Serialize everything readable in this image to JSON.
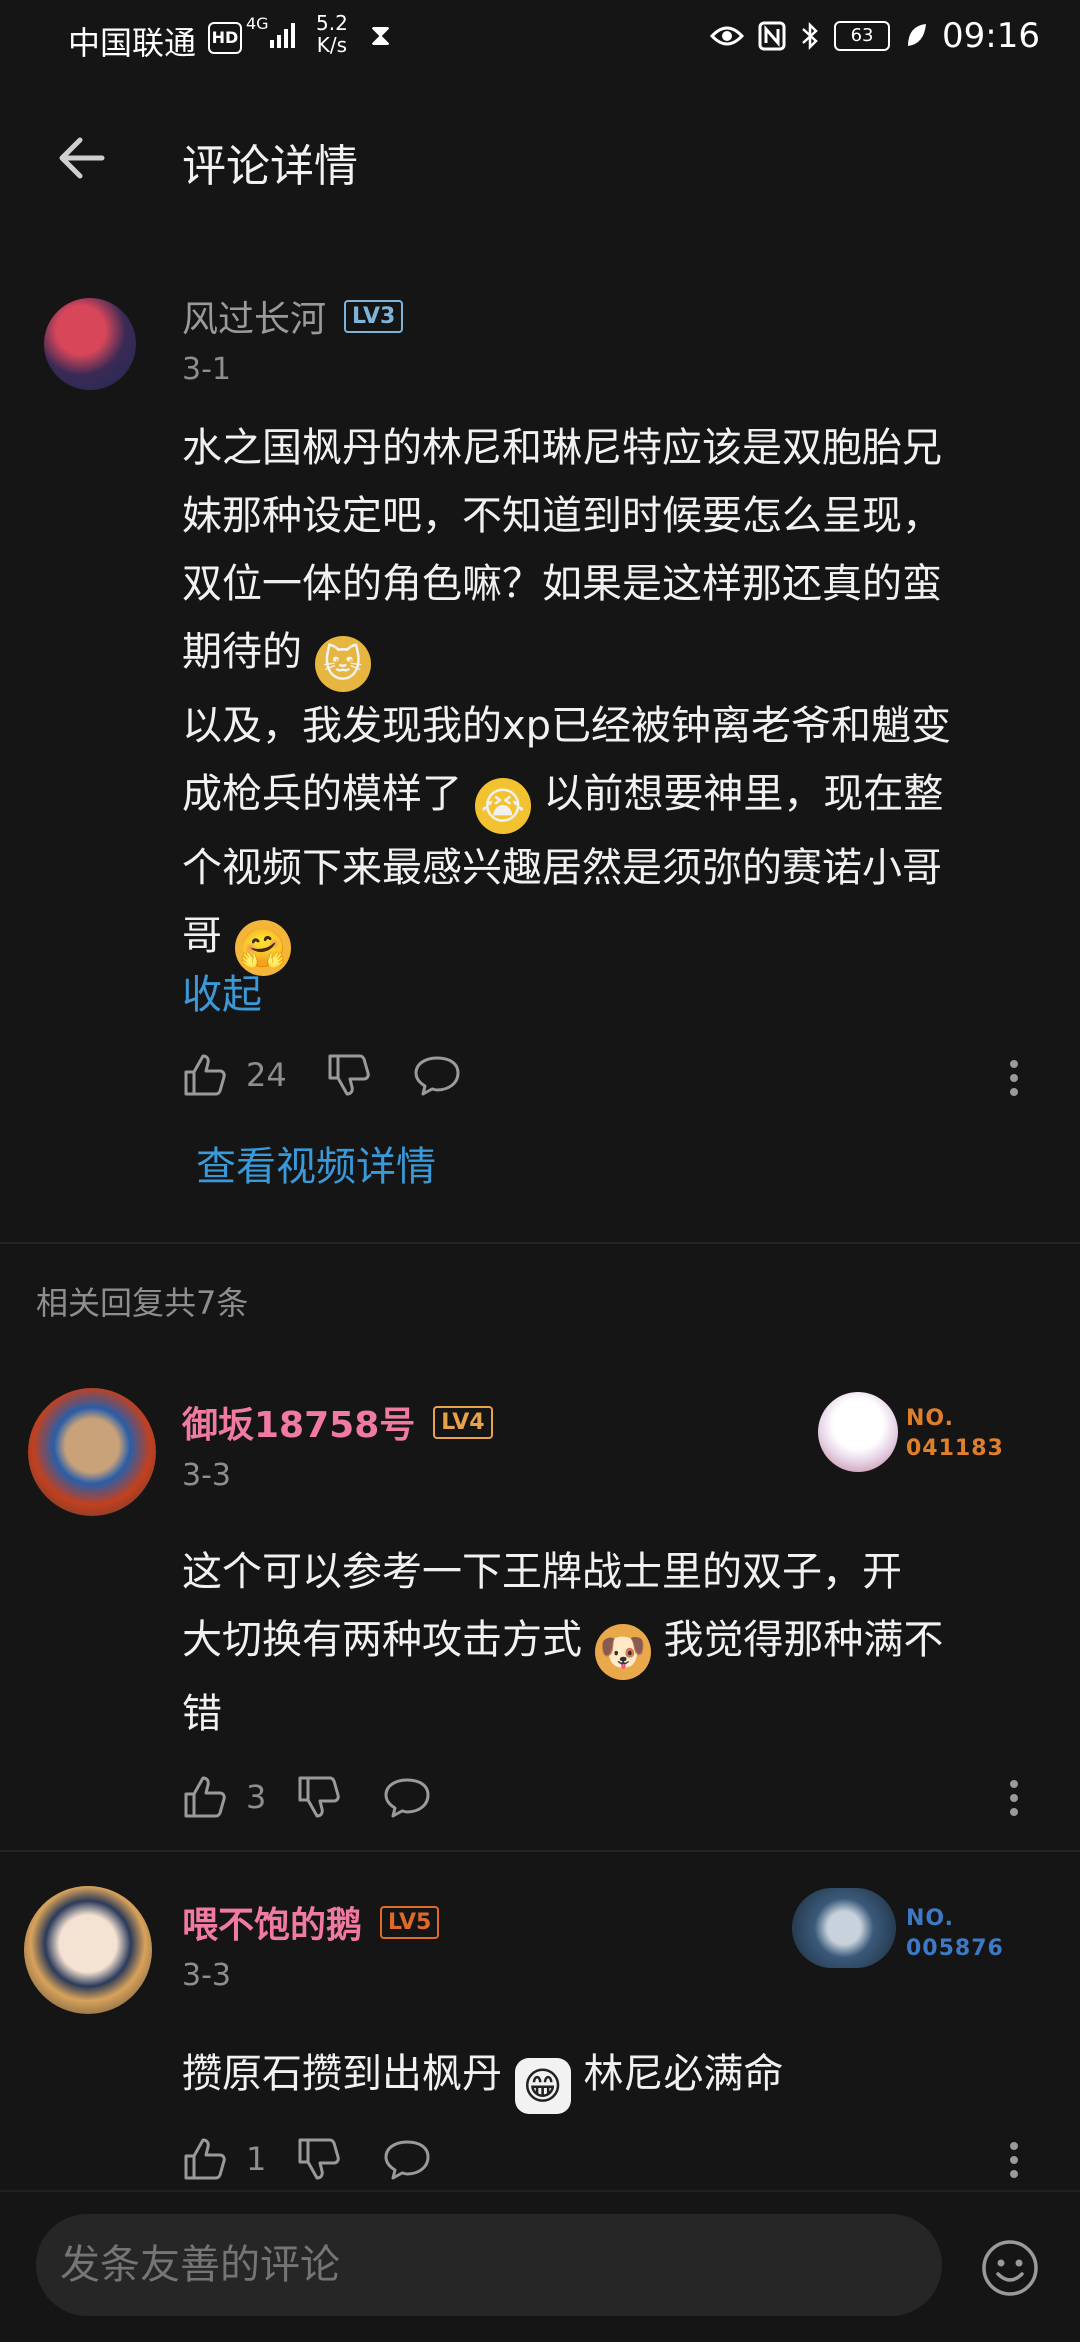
{
  "status_bar": {
    "carrier": "中国联通",
    "hd": "HD",
    "network": "4G",
    "speed_value": "5.2",
    "speed_unit": "K/s",
    "battery": "63",
    "time": "09:16"
  },
  "header": {
    "title": "评论详情"
  },
  "main_comment": {
    "username": "风过长河",
    "level": "LV3",
    "date": "3-1",
    "text_lines": [
      "水之国枫丹的林尼和琳尼特应该是双胞胎兄",
      "妹那种设定吧，不知道到时候要怎么呈现，",
      "双位一体的角色嘛？如果是这样那还真的蛮",
      "期待的",
      "以及，我发现我的xp已经被钟离老爷和魈变",
      "成枪兵的模样了",
      "以前想要神里，现在整",
      "个视频下来最感兴趣居然是须弥的赛诺小哥",
      "哥"
    ],
    "collapse": "收起",
    "likes": "24",
    "view_video": "查看视频详情"
  },
  "replies_header": "相关回复共7条",
  "replies": [
    {
      "username": "御坂18758号",
      "level": "LV4",
      "date": "3-3",
      "badge_label": "NO.",
      "badge_number": "041183",
      "text_lines": [
        "这个可以参考一下王牌战士里的双子，开",
        "大切换有两种攻击方式",
        "我觉得那种满不",
        "错"
      ],
      "likes": "3"
    },
    {
      "username": "喂不饱的鹅",
      "level": "LV5",
      "date": "3-3",
      "badge_label": "NO.",
      "badge_number": "005876",
      "text_lines": [
        "攒原石攒到出枫丹",
        "林尼必满命"
      ],
      "likes": "1"
    }
  ],
  "composer": {
    "placeholder": "发条友善的评论"
  },
  "colors": {
    "accent": "#3a9ad9",
    "pink_name": "#f07aa0",
    "lv3": "#7fb4d8",
    "lv4": "#e8a24a",
    "lv5": "#e06a2a"
  }
}
